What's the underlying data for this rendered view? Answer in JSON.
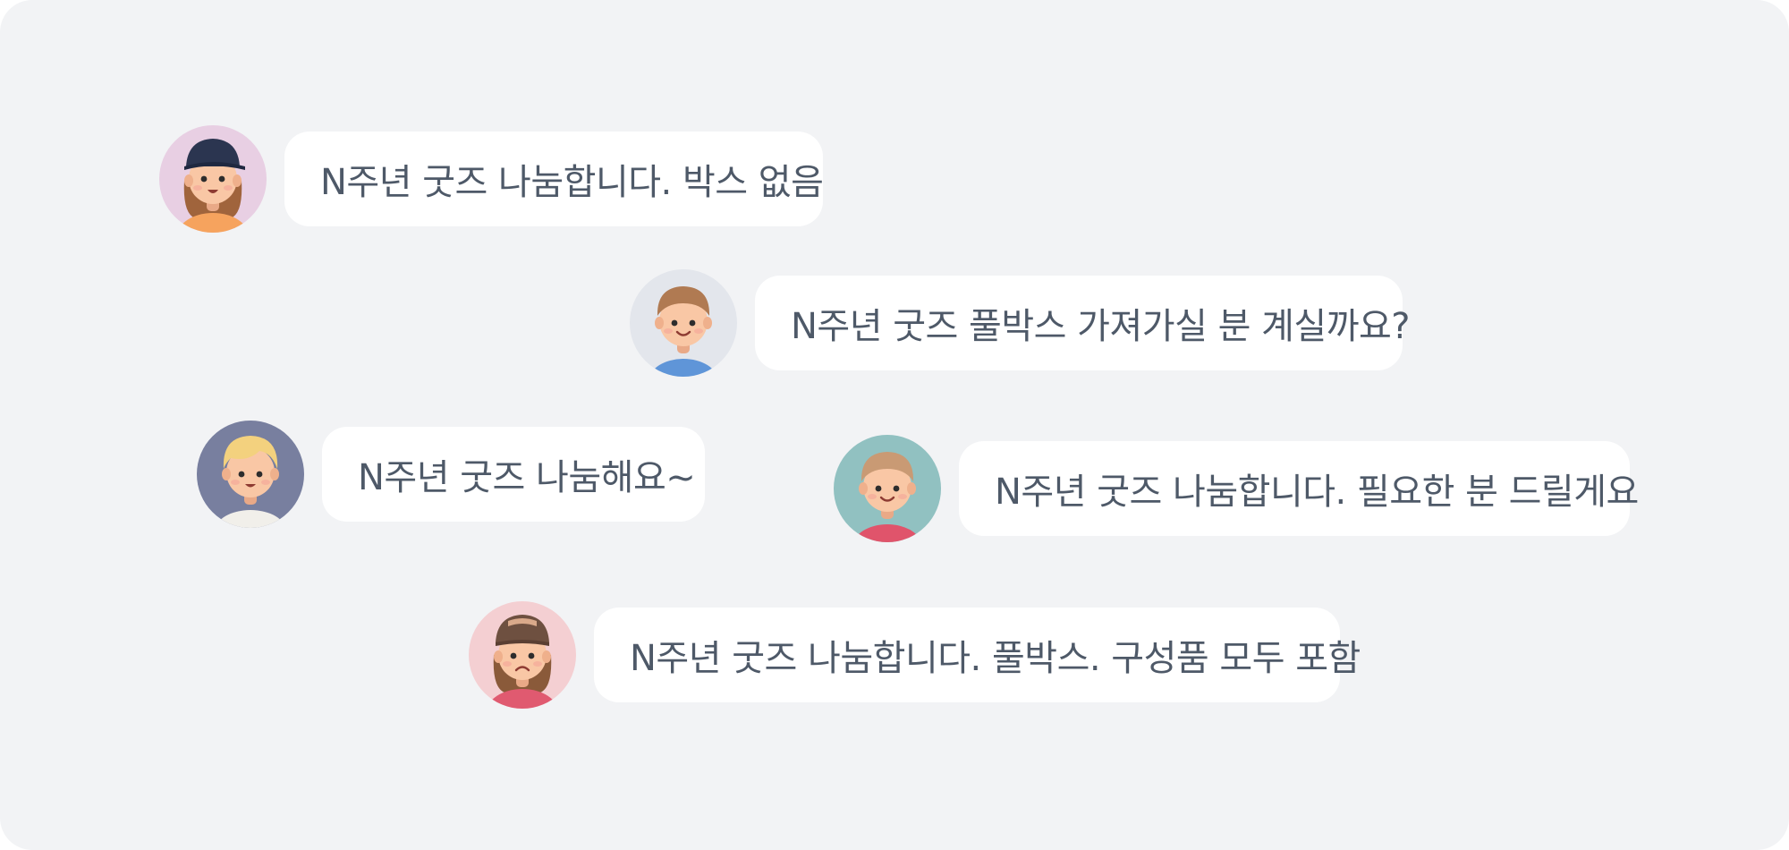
{
  "messages": [
    {
      "avatar": "girl-with-cap-avatar",
      "text": "N주년 굿즈 나눔합니다. 박스 없음"
    },
    {
      "avatar": "boy-avatar",
      "text": "N주년 굿즈 풀박스 가져가실 분 계실까요?"
    },
    {
      "avatar": "blonde-person-avatar",
      "text": "N주년 굿즈 나눔해요~"
    },
    {
      "avatar": "boy-avatar",
      "text": "N주년 굿즈 나눔합니다. 필요한 분 드릴게요"
    },
    {
      "avatar": "sad-girl-with-cap-avatar",
      "text": "N주년 굿즈 나눔합니다. 풀박스. 구성품 모두 포함"
    }
  ],
  "colors": {
    "background": "#f2f3f5",
    "bubble": "#ffffff",
    "text": "#4e5968",
    "avatar_backgrounds": [
      "#e8cfe3",
      "#e3e6ec",
      "#787f9f",
      "#91c1c1",
      "#f4cfd2"
    ]
  }
}
